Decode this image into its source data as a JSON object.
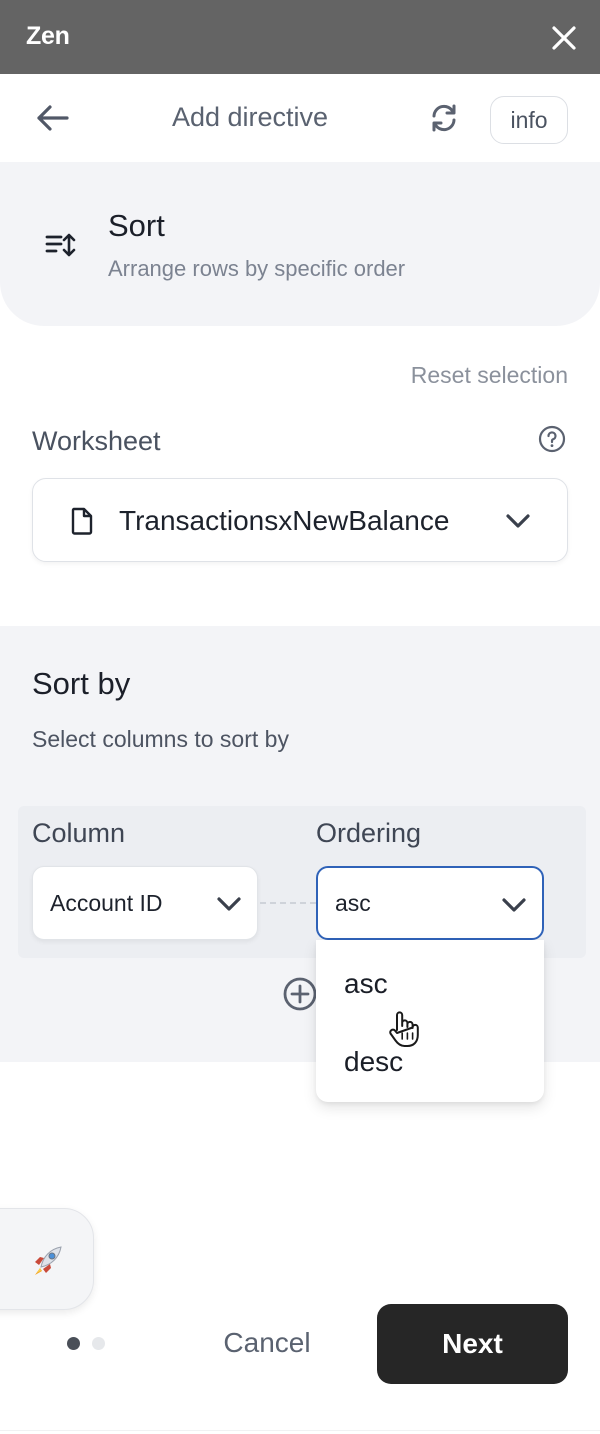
{
  "titlebar": {
    "app_name": "Zen",
    "close_icon": "close-icon"
  },
  "header": {
    "back_icon": "arrow-left-icon",
    "title": "Add directive",
    "refresh_icon": "refresh-icon",
    "info_label": "info"
  },
  "directive": {
    "icon": "sort-icon",
    "name": "Sort",
    "description": "Arrange rows by specific order"
  },
  "reset_label": "Reset selection",
  "worksheet": {
    "label": "Worksheet",
    "help_icon": "question-circle-icon",
    "file_icon": "file-icon",
    "selected": "TransactionsxNewBalance"
  },
  "sort_by": {
    "title": "Sort by",
    "description": "Select columns to sort by",
    "column_label": "Column",
    "ordering_label": "Ordering",
    "column_value": "Account ID",
    "ordering_value": "asc",
    "ordering_options": [
      "asc",
      "desc"
    ],
    "add_icon": "plus-circle-icon"
  },
  "footer": {
    "cancel_label": "Cancel",
    "next_label": "Next",
    "steps_total": 2,
    "step_current": 1,
    "launch_icon": "rocket-icon"
  },
  "colors": {
    "titlebar": "#646464",
    "card_bg": "#f3f4f7",
    "focus_border": "#2f62b8",
    "primary_button": "#262626"
  }
}
